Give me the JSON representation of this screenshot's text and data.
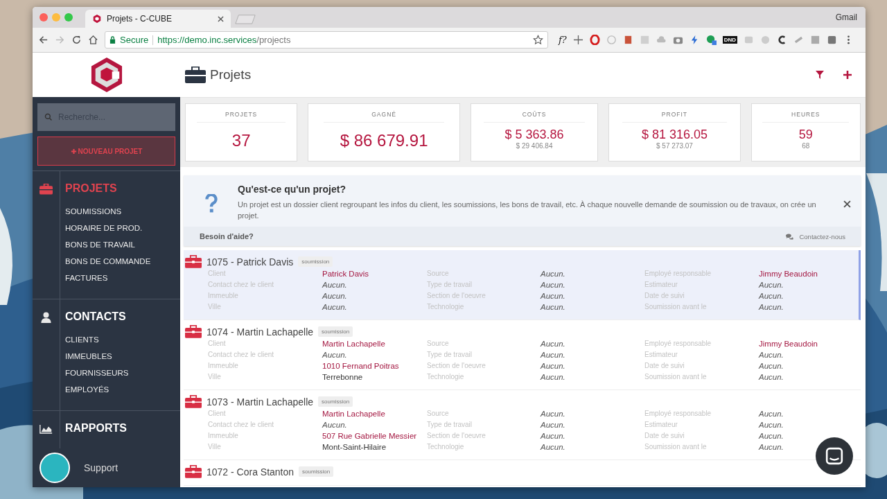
{
  "browser": {
    "tabs": [
      {
        "title": "Projets - C-CUBE",
        "selected": true
      }
    ],
    "profile": "Gmail",
    "secure_label": "Secure",
    "url_host": "https://demo.inc.services",
    "url_path": "/projects",
    "extension_text": "f?",
    "dnd_badge": "DND"
  },
  "sidebar": {
    "search": {
      "placeholder": "Recherche..."
    },
    "new_button": "NOUVEAU PROJET",
    "sections": [
      {
        "kind": "briefcase",
        "title": "PROJETS",
        "selected": true,
        "items": [
          "SOUMISSIONS",
          "HORAIRE DE PROD.",
          "BONS DE TRAVAIL",
          "BONS DE COMMANDE",
          "FACTURES"
        ]
      },
      {
        "kind": "person",
        "title": "CONTACTS",
        "selected": false,
        "items": [
          "CLIENTS",
          "IMMEUBLES",
          "FOURNISSEURS",
          "EMPLOYÉS"
        ]
      },
      {
        "kind": "chart",
        "title": "RAPPORTS",
        "selected": false
      }
    ],
    "support": "Support"
  },
  "header": {
    "title": "Projets"
  },
  "stats": [
    {
      "label": "PROJETS",
      "value": "37"
    },
    {
      "label": "GAGNÉ",
      "value": "$ 86 679.91"
    },
    {
      "label": "COÛTS",
      "value": "$ 5 363.86",
      "sub": "$ 29 406.84"
    },
    {
      "label": "PROFIT",
      "value": "$ 81 316.05",
      "sub": "$ 57 273.07"
    },
    {
      "label": "HEURES",
      "value": "59",
      "sub": "68"
    }
  ],
  "help": {
    "title": "Qu'est-ce qu'un projet?",
    "text": "Un projet est un dossier client regroupant les infos du client, les soumissions, les bons de travail, etc. À chaque nouvelle demande de soumission ou de travaux, on crée un projet.",
    "footer": "Besoin d'aide?",
    "contact": "Contactez-nous"
  },
  "projects": [
    {
      "title": "1075 - Patrick Davis",
      "badge": "soumission",
      "selected": true,
      "groups": [
        [
          {
            "label": "Client",
            "value": "Patrick Davis",
            "kind": "link"
          },
          {
            "label": "Contact chez le client",
            "value": "Aucun.",
            "kind": "none"
          },
          {
            "label": "Immeuble",
            "value": "Aucun.",
            "kind": "none"
          },
          {
            "label": "Ville",
            "value": "Aucun.",
            "kind": "none"
          }
        ],
        [
          {
            "label": "Source",
            "value": "Aucun.",
            "kind": "none"
          },
          {
            "label": "Type de travail",
            "value": "Aucun.",
            "kind": "none"
          },
          {
            "label": "Section de l'oeuvre",
            "value": "Aucun.",
            "kind": "none"
          },
          {
            "label": "Technologie",
            "value": "Aucun.",
            "kind": "none"
          }
        ],
        [
          {
            "label": "Employé responsable",
            "value": "Jimmy Beaudoin",
            "kind": "link"
          },
          {
            "label": "Estimateur",
            "value": "Aucun.",
            "kind": "none"
          },
          {
            "label": "Date de suivi",
            "value": "Aucun.",
            "kind": "none"
          },
          {
            "label": "Soumission avant le",
            "value": "Aucun.",
            "kind": "none"
          }
        ]
      ]
    },
    {
      "title": "1074 - Martin Lachapelle",
      "badge": "soumission",
      "selected": false,
      "groups": [
        [
          {
            "label": "Client",
            "value": "Martin Lachapelle",
            "kind": "link"
          },
          {
            "label": "Contact chez le client",
            "value": "Aucun.",
            "kind": "none"
          },
          {
            "label": "Immeuble",
            "value": "1010 Fernand Poitras",
            "kind": "link"
          },
          {
            "label": "Ville",
            "value": "Terrebonne",
            "kind": "text"
          }
        ],
        [
          {
            "label": "Source",
            "value": "Aucun.",
            "kind": "none"
          },
          {
            "label": "Type de travail",
            "value": "Aucun.",
            "kind": "none"
          },
          {
            "label": "Section de l'oeuvre",
            "value": "Aucun.",
            "kind": "none"
          },
          {
            "label": "Technologie",
            "value": "Aucun.",
            "kind": "none"
          }
        ],
        [
          {
            "label": "Employé responsable",
            "value": "Jimmy Beaudoin",
            "kind": "link"
          },
          {
            "label": "Estimateur",
            "value": "Aucun.",
            "kind": "none"
          },
          {
            "label": "Date de suivi",
            "value": "Aucun.",
            "kind": "none"
          },
          {
            "label": "Soumission avant le",
            "value": "Aucun.",
            "kind": "none"
          }
        ]
      ]
    },
    {
      "title": "1073 - Martin Lachapelle",
      "badge": "soumission",
      "selected": false,
      "groups": [
        [
          {
            "label": "Client",
            "value": "Martin Lachapelle",
            "kind": "link"
          },
          {
            "label": "Contact chez le client",
            "value": "Aucun.",
            "kind": "none"
          },
          {
            "label": "Immeuble",
            "value": "507 Rue Gabrielle Messier",
            "kind": "link"
          },
          {
            "label": "Ville",
            "value": "Mont-Saint-Hilaire",
            "kind": "text"
          }
        ],
        [
          {
            "label": "Source",
            "value": "Aucun.",
            "kind": "none"
          },
          {
            "label": "Type de travail",
            "value": "Aucun.",
            "kind": "none"
          },
          {
            "label": "Section de l'oeuvre",
            "value": "Aucun.",
            "kind": "none"
          },
          {
            "label": "Technologie",
            "value": "Aucun.",
            "kind": "none"
          }
        ],
        [
          {
            "label": "Employé responsable",
            "value": "Aucun.",
            "kind": "none"
          },
          {
            "label": "Estimateur",
            "value": "Aucun.",
            "kind": "none"
          },
          {
            "label": "Date de suivi",
            "value": "Aucun.",
            "kind": "none"
          },
          {
            "label": "Soumission avant le",
            "value": "Aucun.",
            "kind": "none"
          }
        ]
      ]
    },
    {
      "title": "1072 - Cora Stanton",
      "badge": "soumission",
      "selected": false
    }
  ]
}
